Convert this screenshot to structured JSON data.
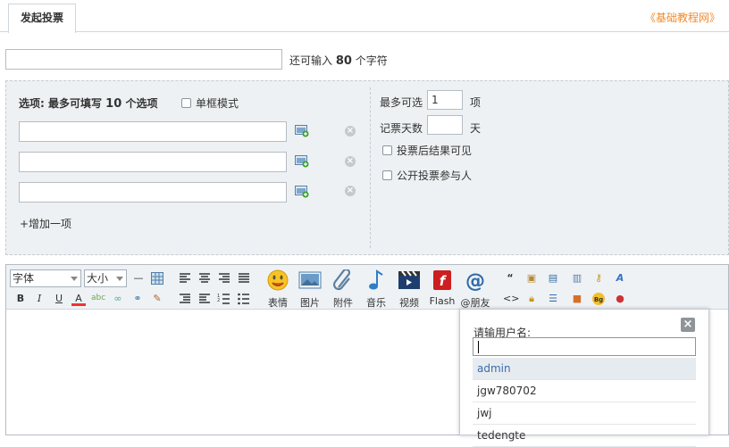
{
  "tabs": {
    "active": "发起投票"
  },
  "brand": "《基础教程网》",
  "subject": {
    "value": "",
    "hint_prefix": "还可输入",
    "hint_count": "80",
    "hint_suffix": "个字符"
  },
  "options": {
    "heading_prefix": "选项: 最多可填写",
    "heading_count": "10",
    "heading_suffix": "个选项",
    "single_mode_label": "单框模式",
    "items": [
      "",
      "",
      ""
    ],
    "add_label": "+增加一项"
  },
  "settings": {
    "max_choice_label": "最多可选",
    "max_choice_value": "1",
    "max_choice_unit": "项",
    "days_label": "记票天数",
    "days_value": "",
    "days_unit": "天",
    "visible_after_label": "投票后结果可见",
    "public_voters_label": "公开投票参与人"
  },
  "toolbar": {
    "font_select": "字体",
    "size_select": "大小",
    "big_buttons": [
      "表情",
      "图片",
      "附件",
      "音乐",
      "视频",
      "Flash",
      "@朋友"
    ]
  },
  "mention_popup": {
    "title": "请输用户名:",
    "input_value": "",
    "suggestions": [
      "admin",
      "jgw780702",
      "jwj",
      "tedengte"
    ]
  },
  "colors": {
    "brand": "#f08b2d",
    "panel_bg": "#eef1f3",
    "active_suggestion": "#3b6caa"
  }
}
